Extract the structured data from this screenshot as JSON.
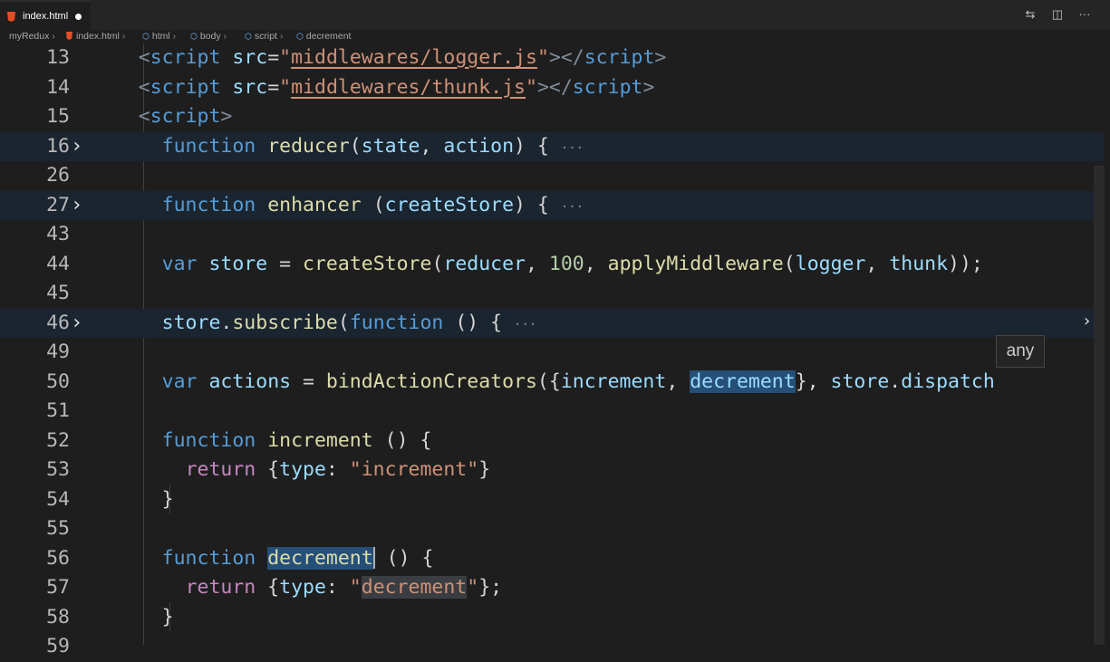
{
  "tab": {
    "file_name": "index.html",
    "icon": "html5-icon",
    "dirty": true
  },
  "tab_actions": [
    {
      "name": "source-control-icon",
      "glyph": "⇆"
    },
    {
      "name": "split-editor-icon",
      "glyph": "◫"
    },
    {
      "name": "more-actions-icon",
      "glyph": "···"
    }
  ],
  "breadcrumb": [
    "myRedux",
    "index.html",
    "html",
    "body",
    "script",
    "decrement"
  ],
  "lines": [
    {
      "n": "13",
      "folded": false,
      "html": "    <span class='tag'>&lt;</span><span class='tn'>script</span> <span class='attr'>src</span>=<span class='str'>\"<span class='ul'>middlewares/logger.js</span>\"</span><span class='tag'>&gt;&lt;/</span><span class='tn'>script</span><span class='tag'>&gt;</span>"
    },
    {
      "n": "14",
      "folded": false,
      "html": "    <span class='tag'>&lt;</span><span class='tn'>script</span> <span class='attr'>src</span>=<span class='str'>\"<span class='ul'>middlewares/thunk.js</span>\"</span><span class='tag'>&gt;&lt;/</span><span class='tn'>script</span><span class='tag'>&gt;</span>"
    },
    {
      "n": "15",
      "folded": false,
      "html": "    <span class='tag'>&lt;</span><span class='tn'>script</span><span class='tag'>&gt;</span>"
    },
    {
      "n": "16",
      "folded": true,
      "html": "      <span class='kw'>function</span> <span class='fn'>reducer</span>(<span class='var'>state</span>, <span class='var'>action</span>) { <span class='ell'>···</span>"
    },
    {
      "n": "26",
      "folded": false,
      "html": ""
    },
    {
      "n": "27",
      "folded": true,
      "html": "      <span class='kw'>function</span> <span class='fn'>enhancer</span> (<span class='var'>createStore</span>) { <span class='ell'>···</span>"
    },
    {
      "n": "43",
      "folded": false,
      "html": ""
    },
    {
      "n": "44",
      "folded": false,
      "html": "      <span class='kw'>var</span> <span class='var'>store</span> = <span class='fn'>createStore</span>(<span class='var'>reducer</span>, <span class='num'>100</span>, <span class='fn'>applyMiddleware</span>(<span class='var'>logger</span>, <span class='var'>thunk</span>));"
    },
    {
      "n": "45",
      "folded": false,
      "html": ""
    },
    {
      "n": "46",
      "folded": true,
      "html": "      <span class='var'>store</span>.<span class='fn'>subscribe</span>(<span class='kw'>function</span> () { <span class='ell'>···</span>"
    },
    {
      "n": "49",
      "folded": false,
      "html": ""
    },
    {
      "n": "50",
      "folded": false,
      "html": "      <span class='kw'>var</span> <span class='var'>actions</span> = <span class='fn'>bindActionCreators</span>({<span class='var'>increment</span>, <span class='var hl'>decrement</span>}, <span class='var'>store</span>.<span class='var'>dispatch</span>"
    },
    {
      "n": "51",
      "folded": false,
      "html": ""
    },
    {
      "n": "52",
      "folded": false,
      "html": "      <span class='kw'>function</span> <span class='fn'>increment</span> () {"
    },
    {
      "n": "53",
      "folded": false,
      "html": "        <span class='kw2'>return</span> {<span class='var'>type</span>: <span class='str'>\"increment\"</span>}"
    },
    {
      "n": "54",
      "folded": false,
      "html": "      }"
    },
    {
      "n": "55",
      "folded": false,
      "html": ""
    },
    {
      "n": "56",
      "folded": false,
      "html": "      <span class='kw'>function</span> <span class='fn hl'>decrement</span><span class='cursor'></span> () {"
    },
    {
      "n": "57",
      "folded": false,
      "html": "        <span class='kw2'>return</span> {<span class='var'>type</span>: <span class='str'>\"<span class='hl2'>decrement</span>\"</span>};"
    },
    {
      "n": "58",
      "folded": false,
      "html": "      }"
    },
    {
      "n": "59",
      "folded": false,
      "html": ""
    }
  ],
  "tooltip": "any"
}
